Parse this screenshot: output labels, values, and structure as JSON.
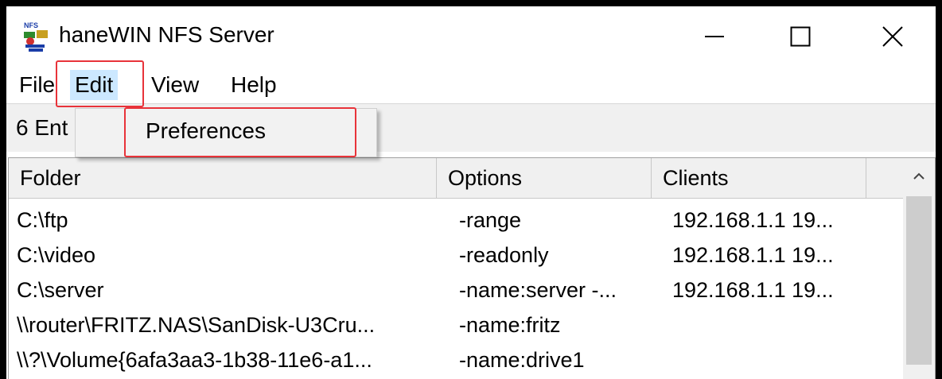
{
  "window": {
    "title": "haneWIN NFS Server",
    "icon": "nfs-app-icon",
    "controls": [
      "minimize-icon",
      "maximize-icon",
      "close-icon"
    ]
  },
  "menubar": {
    "file": "File",
    "edit": "Edit",
    "view": "View",
    "help": "Help"
  },
  "edit_menu": {
    "items": [
      "Preferences"
    ]
  },
  "toolbar": {
    "entries_text": "6 Ent"
  },
  "table": {
    "columns": [
      "Folder",
      "Options",
      "Clients"
    ],
    "rows": [
      {
        "folder": "C:\\ftp",
        "options": "-range",
        "clients": "192.168.1.1 19..."
      },
      {
        "folder": "C:\\video",
        "options": "-readonly",
        "clients": "192.168.1.1 19..."
      },
      {
        "folder": "C:\\server",
        "options": "-name:server -...",
        "clients": "192.168.1.1 19..."
      },
      {
        "folder": "\\\\router\\FRITZ.NAS\\SanDisk-U3Cru...",
        "options": "-name:fritz",
        "clients": ""
      },
      {
        "folder": "\\\\?\\Volume{6afa3aa3-1b38-11e6-a1...",
        "options": "-name:drive1",
        "clients": ""
      }
    ]
  },
  "colors": {
    "highlight_menu": "#cce8ff",
    "annotation": "#e8333a",
    "chrome": "#f0f0f0"
  }
}
